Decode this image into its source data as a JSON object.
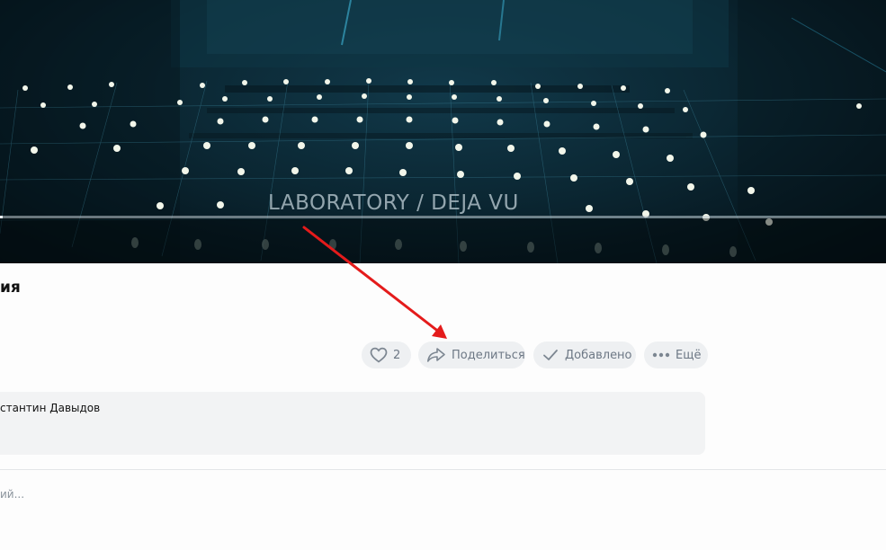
{
  "video": {
    "caption": "LABORATORY / DEJA VU",
    "progress": 0.003
  },
  "title": "ия",
  "actions": {
    "like_count": "2",
    "share_label": "Поделиться",
    "added_label": "Добавлено",
    "more_label": "Ещё"
  },
  "description": {
    "author": "стантин Давыдов"
  },
  "comment": {
    "placeholder": "ий..."
  },
  "colors": {
    "annotation_arrow": "#e41b1b",
    "button_bg": "#eef0f2",
    "button_text": "#6d7885"
  },
  "icons": {
    "like": "heart-icon",
    "share": "share-arrow-icon",
    "added": "checkmark-icon",
    "more": "ellipsis-icon"
  }
}
